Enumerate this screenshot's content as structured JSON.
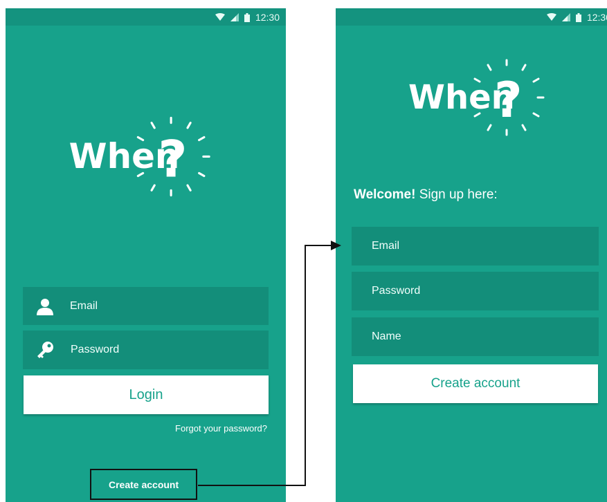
{
  "statusbar": {
    "time": "12:30",
    "icons": [
      "wifi-icon",
      "signal-icon",
      "battery-icon"
    ]
  },
  "brand": {
    "logo_text": "When",
    "logo_symbol": "?"
  },
  "login_screen": {
    "email_label": "Email",
    "email_icon": "user-icon",
    "password_label": "Password",
    "password_icon": "key-icon",
    "login_button": "Login",
    "forgot_password": "Forgot your password?",
    "create_account": "Create account"
  },
  "signup_screen": {
    "welcome_bold": "Welcome!",
    "welcome_rest": "Sign up here:",
    "email_label": "Email",
    "password_label": "Password",
    "name_label": "Name",
    "create_account_button": "Create account"
  },
  "colors": {
    "background": "#17a28b",
    "statusbar": "#14937f",
    "field": "#138e7a",
    "button_text": "#17a28b",
    "annotation": "#111111"
  }
}
